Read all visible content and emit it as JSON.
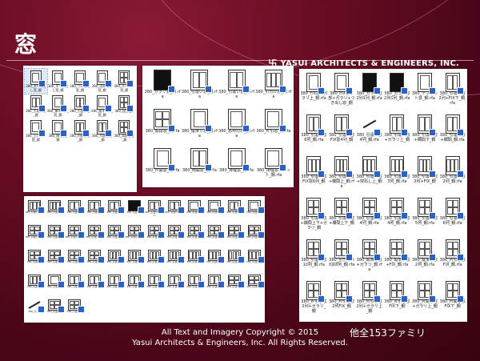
{
  "slide": {
    "title": "窓",
    "brand": "YASUI ARCHITECTS & ENGINEERS, INC.",
    "brand_mark": "卐",
    "footer_line1": "All Text and Imagery Copyright © 2015",
    "footer_line2": "Yasui Architects & Engineers, Inc. All Rights Reserved.",
    "note": "他全153ファミリ"
  },
  "panel_a": {
    "items": [
      {
        "label": "380_すべり出し窓_鋼",
        "kind": "single",
        "selected": true
      },
      {
        "label": "380_すべり出し窓_鋼",
        "kind": "single"
      },
      {
        "label": "380_つき出し窓_鋼",
        "kind": "single"
      },
      {
        "label": "380_はめ殺し窓_鋼",
        "kind": "single"
      },
      {
        "label": "380_ルーバー窓_鋼",
        "kind": "grid"
      },
      {
        "label": "380_引違い窓_鋼",
        "kind": "double"
      },
      {
        "label": "380_横すべり_窓_鋼",
        "kind": "single"
      },
      {
        "label": "380_引違い窓_鋼",
        "kind": "double"
      },
      {
        "label": "380_縦すべり_窓_鋼",
        "kind": "single"
      },
      {
        "label": "380_段窓_鋼",
        "kind": "grid"
      },
      {
        "label": "380_上げ下げ窓_鋼",
        "kind": "single"
      },
      {
        "label": "380_倒し窓_鋼",
        "kind": "single"
      },
      {
        "label": "380_内倒し窓_鋼",
        "kind": "double"
      },
      {
        "label": "380_片開き窓_鋼",
        "kind": "double"
      },
      {
        "label": "380_両開き窓_鋼",
        "kind": "grid"
      }
    ]
  },
  "panel_b": {
    "items": [
      {
        "label": "380_ガラリ窓_鋼.rfa",
        "kind": "dark"
      },
      {
        "label": "380_引違い窓_鋼.rfa",
        "kind": "double"
      },
      {
        "label": "380_引違い窓_鋼.rfa",
        "kind": "double"
      },
      {
        "label": "380_引分け窓_鋼.rfa",
        "kind": "triple"
      },
      {
        "label": "380_縦段窓_鋼.rfa",
        "kind": "grid"
      },
      {
        "label": "380_縦滑り窓_鋼.rfa",
        "kind": "single"
      },
      {
        "label": "380_窓枠のみ_鋼.rfa",
        "kind": "single"
      },
      {
        "label": "380_片引窓_鋼.rfa",
        "kind": "single"
      },
      {
        "label": "380_片開窓_鋼.rfa",
        "kind": "single"
      },
      {
        "label": "380_両開窓_鋼.rfa",
        "kind": "double"
      },
      {
        "label": "380_排煙窓_鋼.rfa",
        "kind": "single"
      },
      {
        "label": "380_排煙窓スリット_鋼.rfa",
        "kind": "single"
      }
    ]
  },
  "panel_c": {
    "items": [
      {
        "label": "380_FIX窓+ガラリ上_鋼.rfa",
        "kind": "single"
      },
      {
        "label": "380_FIX窓下部+ガラリ+つき出し窓_鋼",
        "kind": "single"
      },
      {
        "label": "380_ガラリ窓2列1列_鋼.rfa",
        "kind": "dark"
      },
      {
        "label": "380_ガラリ窓2列1列_鋼.rfa",
        "kind": "dark"
      },
      {
        "label": "380_デフォルト窓_鋼.rfa",
        "kind": "single"
      },
      {
        "label": "380_引違い窓2列+FIX下_鋼.rfa",
        "kind": "double"
      },
      {
        "label": "380_引違い窓6列_鋼.rfa",
        "kind": "double"
      },
      {
        "label": "380_引違い窓FIX窓4列_鋼",
        "kind": "double"
      },
      {
        "label": "380_引違い窓4列_鋼.rfa",
        "kind": "line"
      },
      {
        "label": "380_引違い窓+ガラリ上_鋼",
        "kind": "double"
      },
      {
        "label": "380_引違い窓+欄間下_鋼",
        "kind": "double"
      },
      {
        "label": "380_引違い窓+欄間_鋼.rfa",
        "kind": "double"
      },
      {
        "label": "380_引違い窓FIX窓6列_鋼",
        "kind": "triple"
      },
      {
        "label": "380_引違い窓+欄間上_鋼.rfa",
        "kind": "triple"
      },
      {
        "label": "380_引違い窓+突出し上_鋼",
        "kind": "triple"
      },
      {
        "label": "380_引違い窓3列_鋼.rfa",
        "kind": "triple"
      },
      {
        "label": "380_引違い窓3列+FIX_鋼",
        "kind": "triple"
      },
      {
        "label": "380_引違い窓2列_鋼.rfa",
        "kind": "triple"
      },
      {
        "label": "380_引違い窓+欄間上下+ガラリ_鋼",
        "kind": "grid"
      },
      {
        "label": "380_引違い窓+欄間上下_鋼",
        "kind": "grid"
      },
      {
        "label": "380_引違い窓4列_鋼.rfa",
        "kind": "grid"
      },
      {
        "label": "380_引違い窓4列_鋼.rfa",
        "kind": "grid"
      },
      {
        "label": "380_引違い窓5列_鋼.rfa",
        "kind": "grid"
      },
      {
        "label": "380_引違い窓6列_鋼.rfa",
        "kind": "grid"
      },
      {
        "label": "380_引違い窓10列_鋼.rfa",
        "kind": "grid"
      },
      {
        "label": "380_引分けFIX窓8列_鋼.rfa",
        "kind": "grid"
      },
      {
        "label": "380_縦滑り窓+ガラリ_鋼.rfa",
        "kind": "grid"
      },
      {
        "label": "380_縦滑り窓+FIX_鋼.rfa",
        "kind": "grid"
      },
      {
        "label": "380_縦滑り窓2列_鋼.rfa",
        "kind": "grid"
      },
      {
        "label": "380_片引き窓FIX_鋼.rfa",
        "kind": "grid"
      },
      {
        "label": "380_片引き窓2列+ガラリ_鋼",
        "kind": "grid"
      },
      {
        "label": "380_片引き窓2列FIX_鋼",
        "kind": "grid"
      },
      {
        "label": "380_片引き窓2列+ガラリ上_鋼",
        "kind": "grid"
      },
      {
        "label": "380_片引き窓FIX下_鋼",
        "kind": "grid"
      },
      {
        "label": "380_片開き窓+ガラリ上_鋼",
        "kind": "grid"
      },
      {
        "label": "380_片開き窓FIX下_鋼",
        "kind": "grid"
      }
    ]
  },
  "panel_d": {
    "items": [
      {
        "label": "380_引違い窓FIX",
        "kind": "triple"
      },
      {
        "label": "380_引違い窓",
        "kind": "triple"
      },
      {
        "label": "380_引違い窓",
        "kind": "double"
      },
      {
        "label": "380_引違い窓",
        "kind": "double"
      },
      {
        "label": "380_引違い窓",
        "kind": "double"
      },
      {
        "label": "380_引違い窓",
        "kind": "dark"
      },
      {
        "label": "380_引違い窓FIX上",
        "kind": "double"
      },
      {
        "label": "380_引違い窓FIX",
        "kind": "double"
      },
      {
        "label": "380_引違い窓",
        "kind": "single"
      },
      {
        "label": "380_引違い窓",
        "kind": "single"
      },
      {
        "label": "380_引違い窓",
        "kind": "double"
      },
      {
        "label": "380_引違い窓",
        "kind": "single"
      },
      {
        "label": "380_引違い窓FIX",
        "kind": "grid"
      },
      {
        "label": "380_引違い窓",
        "kind": "grid"
      },
      {
        "label": "380_引違い窓FIX",
        "kind": "grid"
      },
      {
        "label": "380_引違い窓下",
        "kind": "grid"
      },
      {
        "label": "380_引違い窓",
        "kind": "grid"
      },
      {
        "label": "380_引違い窓FIX",
        "kind": "grid"
      },
      {
        "label": "380_引違い窓",
        "kind": "grid"
      },
      {
        "label": "380_引違い窓",
        "kind": "grid"
      },
      {
        "label": "380_引違い窓",
        "kind": "grid"
      },
      {
        "label": "380_引違い窓",
        "kind": "grid"
      },
      {
        "label": "380_引違い窓",
        "kind": "grid"
      },
      {
        "label": "380_引違い窓",
        "kind": "grid"
      },
      {
        "label": "380_引違い窓",
        "kind": "grid"
      },
      {
        "label": "380_引違い窓",
        "kind": "grid"
      },
      {
        "label": "380_引違い窓",
        "kind": "grid"
      },
      {
        "label": "380_引違い窓",
        "kind": "grid"
      },
      {
        "label": "380_引違い窓",
        "kind": "triple"
      },
      {
        "label": "380_引違い窓",
        "kind": "triple"
      },
      {
        "label": "380_引違い窓",
        "kind": "triple"
      },
      {
        "label": "380_引違い窓",
        "kind": "triple"
      },
      {
        "label": "380_引違い窓",
        "kind": "triple"
      },
      {
        "label": "380_引違い窓",
        "kind": "triple"
      },
      {
        "label": "380_引違い窓",
        "kind": "triple"
      },
      {
        "label": "380_引違い窓",
        "kind": "triple"
      },
      {
        "label": "380_引違い窓",
        "kind": "triple"
      },
      {
        "label": "380_引違い窓",
        "kind": "single"
      },
      {
        "label": "380_引違い窓",
        "kind": "double"
      },
      {
        "label": "380_引違い窓",
        "kind": "double"
      },
      {
        "label": "380_引違い窓",
        "kind": "double"
      },
      {
        "label": "380_引違い窓",
        "kind": "double"
      },
      {
        "label": "380_引違い窓",
        "kind": "double"
      },
      {
        "label": "380_引違い窓",
        "kind": "double"
      },
      {
        "label": "380_引違い窓",
        "kind": "double"
      },
      {
        "label": "380_引違い窓",
        "kind": "double"
      },
      {
        "label": "380_引違い窓",
        "kind": "grid"
      },
      {
        "label": "380_引違い窓",
        "kind": "grid"
      },
      {
        "label": "380_ガラリ",
        "kind": "line"
      },
      {
        "label": "380_引違い窓",
        "kind": "grid"
      },
      {
        "label": "380_引違い窓",
        "kind": "grid"
      }
    ]
  }
}
